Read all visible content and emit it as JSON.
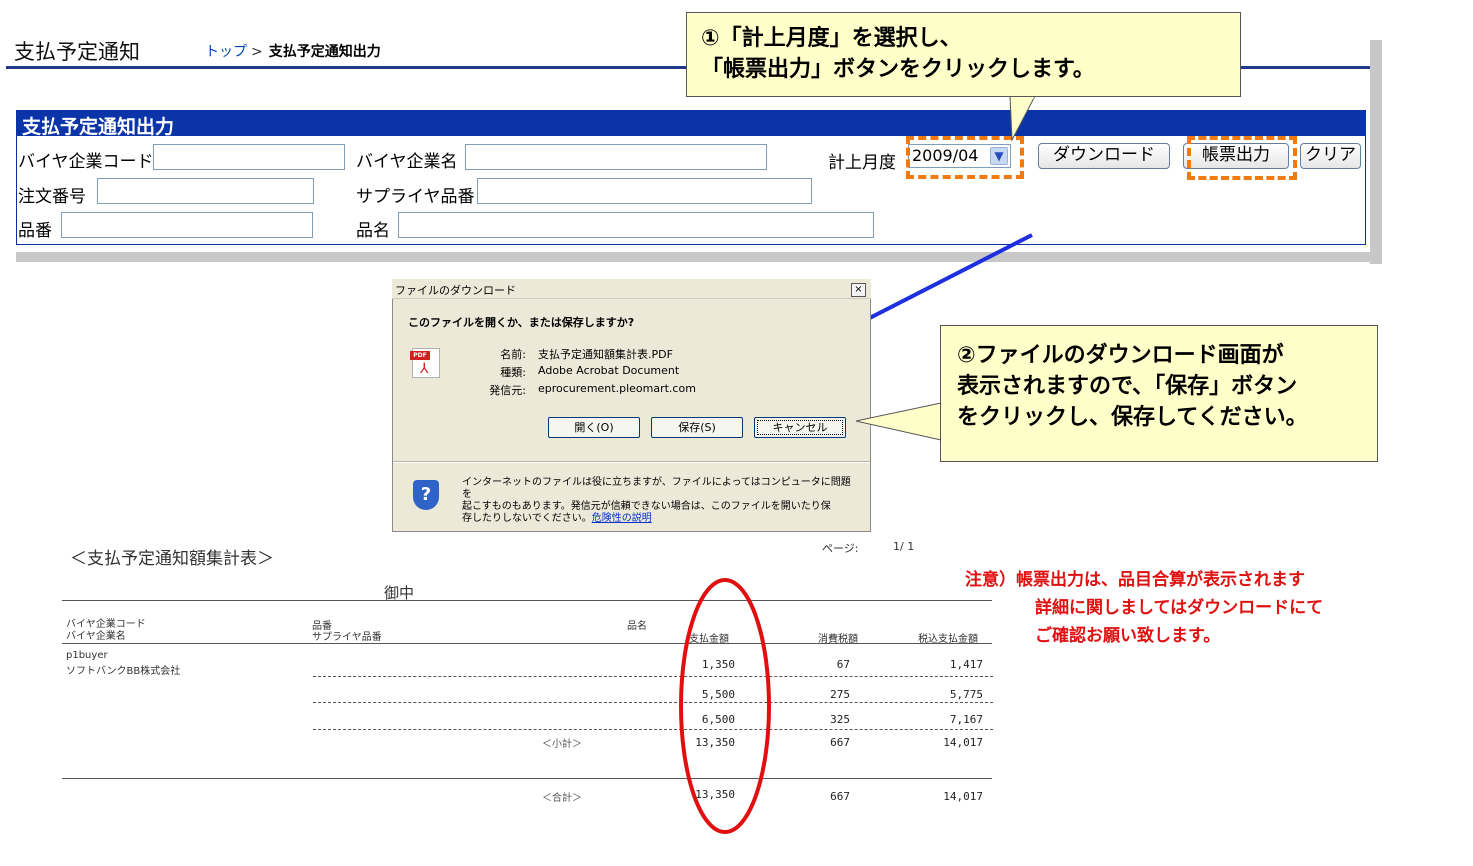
{
  "header": {
    "page_title": "支払予定通知",
    "breadcrumb_top": "トップ",
    "breadcrumb_sep": ">",
    "breadcrumb_current": "支払予定通知出力"
  },
  "form": {
    "section_title": "支払予定通知出力",
    "buyer_code_label": "バイヤ企業コード",
    "buyer_name_label": "バイヤ企業名",
    "month_label": "計上月度",
    "month_value": "2009/04",
    "download_button": "ダウンロード",
    "report_button": "帳票出力",
    "clear_button": "クリア",
    "order_no_label": "注文番号",
    "supplier_item_label": "サプライヤ品番",
    "item_no_label": "品番",
    "item_name_label": "品名"
  },
  "callouts": {
    "step1_line1": "①「計上月度」を選択し、",
    "step1_line2": "「帳票出力」ボタンをクリックします。",
    "step2_line1": "②ファイルのダウンロード画面が",
    "step2_line2": "表示されますので、「保存」ボタン",
    "step2_line3": "をクリックし、保存してください。"
  },
  "dialog": {
    "title": "ファイルのダウンロード",
    "close": "×",
    "question": "このファイルを開くか、または保存しますか?",
    "name_key": "名前:",
    "name_value": "支払予定通知額集計表.PDF",
    "type_key": "種類:",
    "type_value": "Adobe Acrobat Document",
    "from_key": "発信元:",
    "from_value": "eprocurement.pleomart.com",
    "open_button": "開く(O)",
    "save_button": "保存(S)",
    "cancel_button": "キャンセル",
    "warning_line1": "インターネットのファイルは役に立ちますが、ファイルによってはコンピュータに問題を",
    "warning_line2": "起こすものもあります。発信元が信頼できない場合は、このファイルを開いたり保",
    "warning_line3": "存したりしないでください。",
    "warning_link": "危険性の説明",
    "pdf_tag": "PDF",
    "shield_glyph": "?"
  },
  "report": {
    "title": "＜支払予定通知額集計表＞",
    "page_label": "ページ:",
    "page_value": "1/  1",
    "onchu": "御中",
    "col_buyer_code": "バイヤ企業コード",
    "col_buyer_name": "バイヤ企業名",
    "col_item_no": "品番",
    "col_supplier_item": "サプライヤ品番",
    "col_item_name": "品名",
    "col_amount": "支払金額",
    "col_tax": "消費税額",
    "col_total": "税込支払金額",
    "buyer_code": "p1buyer",
    "buyer_name": "ソフトバンクBB株式会社",
    "rows": [
      {
        "amount": "1,350",
        "tax": "67",
        "total": "1,417"
      },
      {
        "amount": "5,500",
        "tax": "275",
        "total": "5,775"
      },
      {
        "amount": "6,500",
        "tax": "325",
        "total": "7,167"
      }
    ],
    "subtotal_label": "＜小計＞",
    "subtotal": {
      "amount": "13,350",
      "tax": "667",
      "total": "14,017"
    },
    "grandtotal_label": "＜合計＞",
    "grandtotal": {
      "amount": "13,350",
      "tax": "667",
      "total": "14,017"
    }
  },
  "note": {
    "line1": "注意）帳票出力は、品目合算が表示されます",
    "line2": "詳細に関しましてはダウンロードにて",
    "line3": "ご確認お願い致します。"
  },
  "colors": {
    "panel_header": "#0a34a7",
    "highlight": "#f07a10",
    "callout_bg": "#ffffc9",
    "note_text": "#e01010",
    "ellipse": "#e01010",
    "arrow": "#1d2fe0"
  }
}
